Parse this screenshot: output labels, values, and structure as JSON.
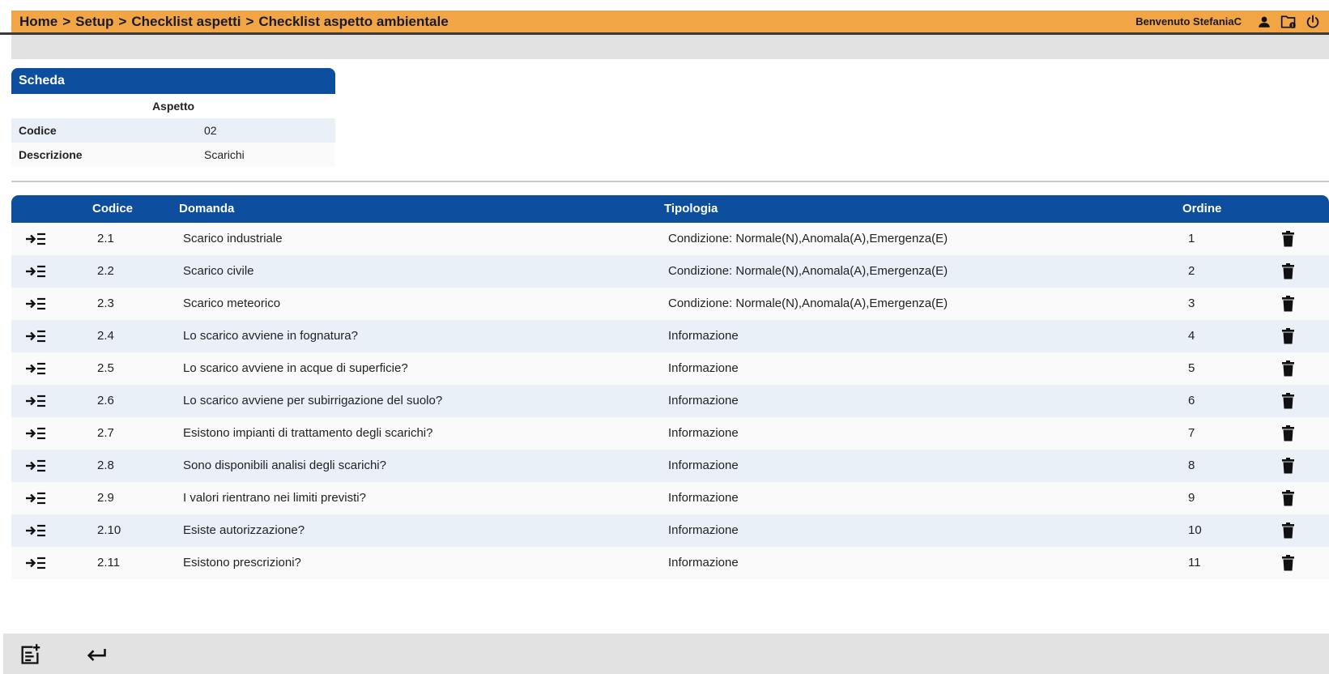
{
  "header": {
    "breadcrumb": [
      "Home",
      "Setup",
      "Checklist aspetti",
      "Checklist aspetto ambientale"
    ],
    "separator": ">",
    "welcome": "Benvenuto StefaniaC",
    "icons": [
      "user-icon",
      "folder-notification-icon",
      "power-icon"
    ]
  },
  "scheda": {
    "title": "Scheda",
    "subtitle": "Aspetto",
    "fields": [
      {
        "label": "Codice",
        "value": "02"
      },
      {
        "label": "Descrizione",
        "value": "Scarichi"
      }
    ]
  },
  "table": {
    "headers": {
      "codice": "Codice",
      "domanda": "Domanda",
      "tipologia": "Tipologia",
      "ordine": "Ordine"
    },
    "rows": [
      {
        "codice": "2.1",
        "domanda": "Scarico industriale",
        "tipologia": "Condizione: Normale(N),Anomala(A),Emergenza(E)",
        "ordine": "1"
      },
      {
        "codice": "2.2",
        "domanda": "Scarico civile",
        "tipologia": "Condizione: Normale(N),Anomala(A),Emergenza(E)",
        "ordine": "2"
      },
      {
        "codice": "2.3",
        "domanda": "Scarico meteorico",
        "tipologia": "Condizione: Normale(N),Anomala(A),Emergenza(E)",
        "ordine": "3"
      },
      {
        "codice": "2.4",
        "domanda": "Lo scarico avviene in fognatura?",
        "tipologia": "Informazione",
        "ordine": "4"
      },
      {
        "codice": "2.5",
        "domanda": "Lo scarico avviene in acque di superficie?",
        "tipologia": "Informazione",
        "ordine": "5"
      },
      {
        "codice": "2.6",
        "domanda": "Lo scarico avviene per subirrigazione del suolo?",
        "tipologia": "Informazione",
        "ordine": "6"
      },
      {
        "codice": "2.7",
        "domanda": "Esistono impianti di trattamento degli scarichi?",
        "tipologia": "Informazione",
        "ordine": "7"
      },
      {
        "codice": "2.8",
        "domanda": "Sono disponibili analisi degli scarichi?",
        "tipologia": "Informazione",
        "ordine": "8"
      },
      {
        "codice": "2.9",
        "domanda": "I valori rientrano nei limiti previsti?",
        "tipologia": "Informazione",
        "ordine": "9"
      },
      {
        "codice": "2.10",
        "domanda": "Esiste autorizzazione?",
        "tipologia": "Informazione",
        "ordine": "10"
      },
      {
        "codice": "2.11",
        "domanda": "Esistono prescrizioni?",
        "tipologia": "Informazione",
        "ordine": "11"
      }
    ]
  },
  "footer": {
    "buttons": [
      "add-note-icon",
      "back-arrow-icon"
    ]
  },
  "colors": {
    "header_bar": "#F1A544",
    "accent_blue": "#0D4E9E",
    "row_alt": "#EAF0F8",
    "footer_bg": "#e2e2e2"
  }
}
